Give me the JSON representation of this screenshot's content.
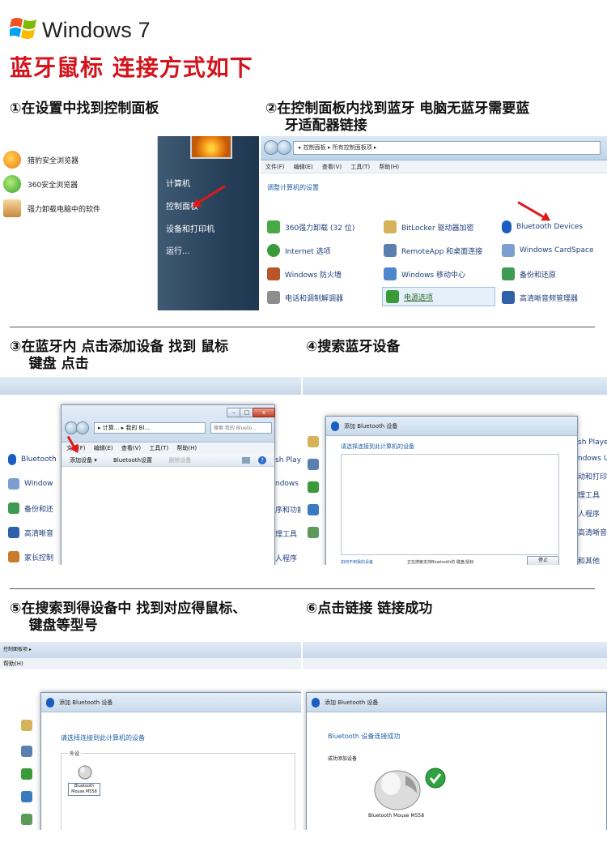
{
  "header": {
    "os_title": "Windows 7",
    "main_title": "蓝牙鼠标  连接方式如下"
  },
  "steps": [
    {
      "caption": "①在设置中找到控制面板"
    },
    {
      "caption": "②在控制面板内找到蓝牙 电脑无蓝牙需要蓝\n    牙适配器链接"
    },
    {
      "caption": "③在蓝牙内 点击添加设备 找到 鼠标\n    键盘 点击"
    },
    {
      "caption": "④搜索蓝牙设备"
    },
    {
      "caption": "⑤在搜索到得设备中 找到对应得鼠标、\n    键盘等型号"
    },
    {
      "caption": "⑥点击链接 链接成功"
    }
  ],
  "start_menu": {
    "left_items": [
      "猎豹安全浏览器",
      "360安全浏览器",
      "强力卸载电脑中的软件"
    ],
    "right_items": [
      "计算机",
      "控制面板",
      "设备和打印机",
      "运行..."
    ]
  },
  "control_panel": {
    "address": "▸ 控制面板 ▸ 所有控制面板项 ▸",
    "menu": [
      "文件(F)",
      "编辑(E)",
      "查看(V)",
      "工具(T)",
      "帮助(H)"
    ],
    "heading": "调整计算机的设置",
    "items": [
      [
        "360强力卸载 (32 位)",
        "BitLocker 驱动器加密",
        "Bluetooth Devices"
      ],
      [
        "Internet 选项",
        "RemoteApp 和桌面连接",
        "Windows CardSpace"
      ],
      [
        "Windows 防火墙",
        "Windows 移动中心",
        "备份和还原"
      ],
      [
        "电话和调制解调器",
        "电源选项",
        "高清晰音频管理器"
      ]
    ],
    "colors": {
      "accent": "#e01818",
      "link": "#1f3f7a"
    }
  },
  "step3": {
    "address": "▸ 计算... ▸ 我的 Bl...",
    "search_placeholder": "搜索 我的 Blueto...",
    "menu": [
      "文件(F)",
      "编辑(E)",
      "查看(V)",
      "工具(T)",
      "帮助(H)"
    ],
    "toolbar": {
      "add": "添加设备 ▾",
      "settings": "Bluetooth设置",
      "delete": "删除设备"
    },
    "bg_items": [
      "Bluetooth",
      "Window",
      "备份和还",
      "高清晰音",
      "家长控制"
    ],
    "bg_right": [
      "sh Playe",
      "ndows C",
      "序和功能",
      "理工具",
      "人程序"
    ]
  },
  "step4": {
    "title": "添加 Bluetooth 设备",
    "prompt": "请选择连接到此计算机的设备",
    "footer_link": "如何不到我的设备",
    "footer_status": "正在搜索支持Bluetooth的 键盘/鼠标",
    "stop": "停止",
    "bg_right": [
      "sh Player",
      "ndows Up",
      "动和打印",
      "理工具",
      "人程序",
      "高清晰音",
      "和其他"
    ]
  },
  "step5": {
    "menu_bar": "帮助(H)",
    "crumb": "控制面板项 ▸",
    "title": "添加 Bluetooth 设备",
    "prompt": "请选择连接到此计算机的设备",
    "group": "外设",
    "device": "Bluetooth\nMouse M558"
  },
  "step6": {
    "title": "添加 Bluetooth 设备",
    "success": "Bluetooth 设备连接成功",
    "sub": "成功添加设备",
    "device": "Bluetooth Mouse M558"
  }
}
